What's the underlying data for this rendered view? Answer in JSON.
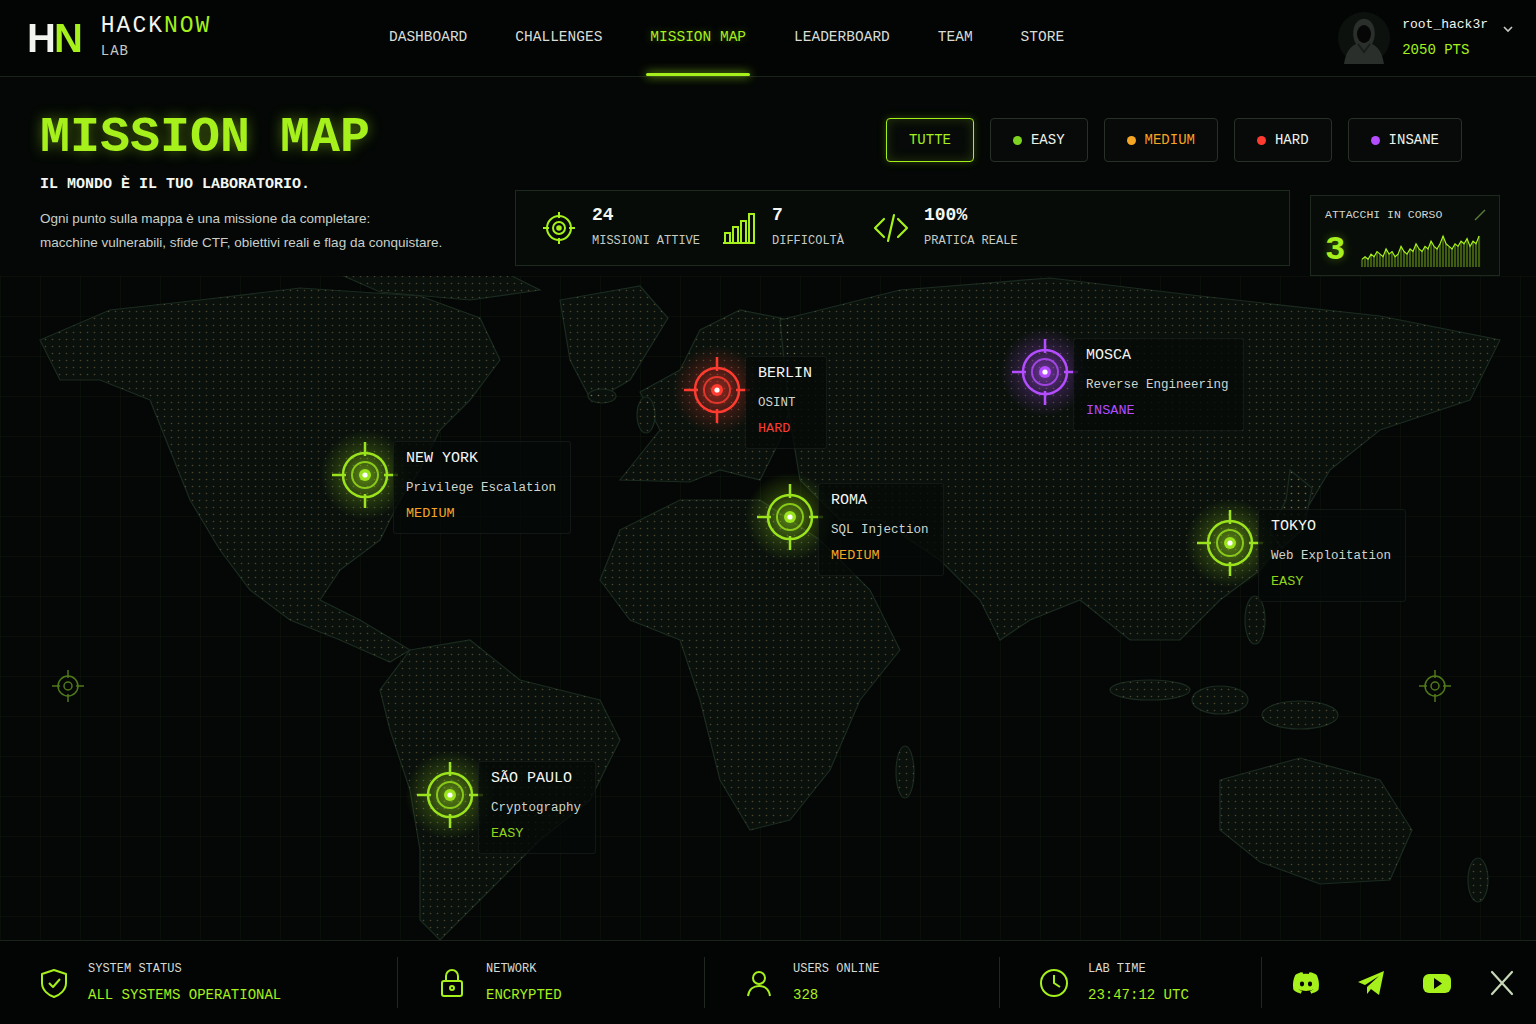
{
  "brand": {
    "mark": "HN",
    "name_a": "HACK",
    "name_b": "NOW",
    "sub": "LAB"
  },
  "nav": [
    {
      "label": "DASHBOARD",
      "selected": false
    },
    {
      "label": "CHALLENGES",
      "selected": false
    },
    {
      "label": "MISSION MAP",
      "selected": true
    },
    {
      "label": "LEADERBOARD",
      "selected": false
    },
    {
      "label": "TEAM",
      "selected": false
    },
    {
      "label": "STORE",
      "selected": false
    }
  ],
  "user": {
    "name": "root_hack3r",
    "points": "2050 PTS"
  },
  "header": {
    "title": "MISSION MAP",
    "subtitle": "IL MONDO È IL TUO LABORATORIO.",
    "description": [
      "Ogni punto sulla mappa è una missione da completare:",
      "macchine vulnerabili, sfide CTF, obiettivi reali e flag da conquistare."
    ]
  },
  "filters": [
    {
      "label": "TUTTE",
      "selected": true,
      "text_color": "#a6f01c"
    },
    {
      "label": "EASY",
      "selected": false,
      "color": "#7ed321",
      "text_color": "#eef2ec"
    },
    {
      "label": "MEDIUM",
      "selected": false,
      "color": "#f5a524",
      "text_color": "#f5a524"
    },
    {
      "label": "HARD",
      "selected": false,
      "color": "#ff3b30",
      "text_color": "#eef2ec"
    },
    {
      "label": "INSANE",
      "selected": false,
      "color": "#b44cff",
      "text_color": "#eef2ec"
    }
  ],
  "stats": [
    {
      "value": "24",
      "label": "MISSIONI ATTIVE"
    },
    {
      "value": "7",
      "label": "DIFFICOLTÀ"
    },
    {
      "value": "100%",
      "label": "PRATICA REALE"
    }
  ],
  "attacks": {
    "label": "ATTACCHI IN CORSO",
    "value": "3",
    "chart": {
      "values": [
        3,
        4,
        3,
        5,
        4,
        6,
        5,
        4,
        7,
        5,
        6,
        4,
        5,
        8,
        6,
        5,
        7,
        6,
        9,
        7,
        6,
        8,
        7,
        10,
        8,
        7,
        9,
        12,
        9,
        8,
        7,
        9,
        8,
        10,
        9,
        11,
        8,
        10,
        9,
        12
      ]
    }
  },
  "missions": [
    {
      "city": "NEW YORK",
      "category": "Privilege Escalation",
      "difficulty": "MEDIUM",
      "color": "#9be31c",
      "difficulty_color": "#f5a524"
    },
    {
      "city": "BERLIN",
      "category": "OSINT",
      "difficulty": "HARD",
      "color": "#ff3b30",
      "difficulty_color": "#ff3b30"
    },
    {
      "city": "MOSCA",
      "category": "Reverse Engineering",
      "difficulty": "INSANE",
      "color": "#b44cff",
      "difficulty_color": "#b44cff"
    },
    {
      "city": "ROMA",
      "category": "SQL Injection",
      "difficulty": "MEDIUM",
      "color": "#9be31c",
      "difficulty_color": "#f5a524"
    },
    {
      "city": "TOKYO",
      "category": "Web Exploitation",
      "difficulty": "EASY",
      "color": "#9be31c",
      "difficulty_color": "#8fd31c"
    },
    {
      "city": "SÃO PAULO",
      "category": "Cryptography",
      "difficulty": "EASY",
      "color": "#9be31c",
      "difficulty_color": "#8fd31c"
    }
  ],
  "status_bar": [
    {
      "label": "SYSTEM STATUS",
      "value": "ALL SYSTEMS OPERATIONAL"
    },
    {
      "label": "NETWORK",
      "value": "ENCRYPTED"
    },
    {
      "label": "USERS ONLINE",
      "value": "328"
    },
    {
      "label": "LAB TIME",
      "value": "23:47:12 UTC"
    }
  ]
}
